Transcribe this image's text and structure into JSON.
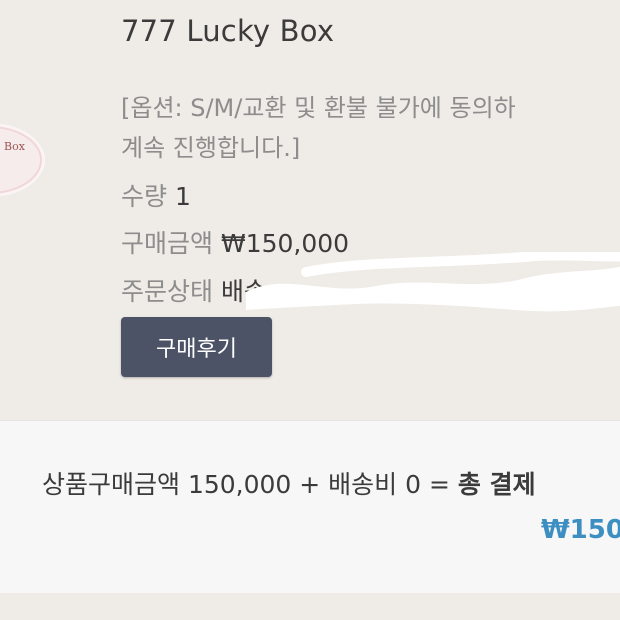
{
  "order": {
    "thumbnail_text": "Box",
    "product_name": "777 Lucky Box",
    "option_line1": "[옵션: S/M/교환 및 환불 불가에 동의하",
    "option_line2": "계속 진행합니다.]",
    "quantity_label": "수량",
    "quantity_value": "1",
    "price_label": "구매금액",
    "price_value": "₩150,000",
    "status_label": "주문상태",
    "status_value": "배송",
    "review_button": "구매후기"
  },
  "summary": {
    "formula": "상품구매금액 150,000 + 배송비 0 = ",
    "total_label": "총 결제",
    "total_amount": "₩150",
    "accent_color": "#3d8fc2"
  },
  "colors": {
    "background": "#efebe6",
    "summary_background": "#f7f7f8",
    "button": "#4c5366"
  }
}
